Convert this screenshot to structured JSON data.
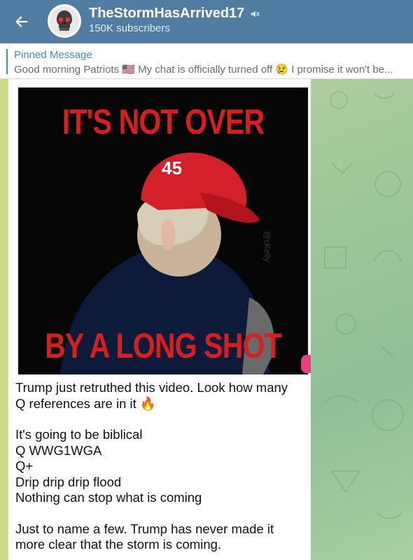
{
  "header": {
    "channel_name": "TheStormHasArrived17",
    "subscribers": "150K subscribers",
    "muted_icon": "speaker-muted-icon",
    "back_icon": "arrow-left-icon",
    "avatar_icon": "skull-avatar-icon"
  },
  "pinned": {
    "label": "Pinned Message",
    "text": "Good morning Patriots 🇺🇸  My chat is officially turned off 😢  I promise it won't be..."
  },
  "message": {
    "image_top_text": "IT'S NOT OVER",
    "image_bottom_text": "BY A LONG SHOT",
    "image_cap_number": "45",
    "lines_1": [
      "Trump just retruthed this video. Look how many",
      "Q references are in it 🔥"
    ],
    "lines_2": [
      "It's going to be biblical",
      "Q WWG1WGA",
      "Q+",
      "Drip drip drip flood",
      "Nothing can stop what is coming"
    ],
    "lines_3": [
      "Just to name a few. Trump has never made it",
      "more clear that the storm is coming."
    ]
  },
  "colors": {
    "header_bg": "#517da2",
    "accent": "#3a8ed1",
    "image_text": "#d61f1f"
  }
}
